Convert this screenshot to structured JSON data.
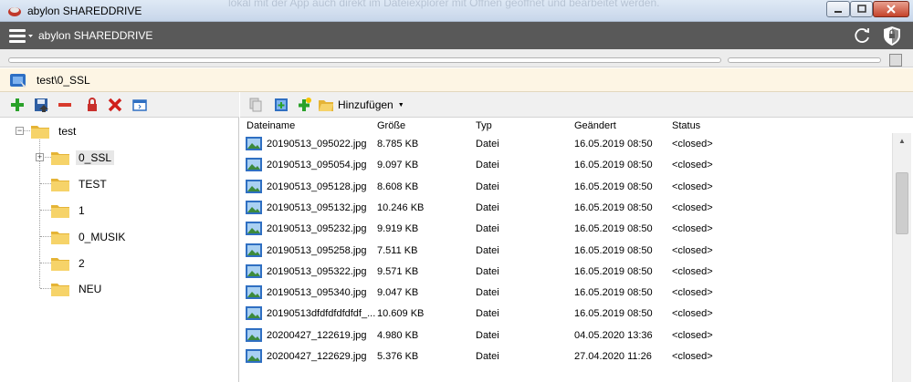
{
  "window": {
    "title": "abylon SHAREDDRIVE",
    "background_text": "lokal mit der App auch direkt im Dateiexplorer mit Öffnen geöffnet und bearbeitet werden."
  },
  "app_header": {
    "name": "abylon SHAREDDRIVE",
    "icons": [
      "menu-icon",
      "sync-icon",
      "shield-icon"
    ]
  },
  "progress": {
    "main_value": 0,
    "secondary_value": 0
  },
  "path": {
    "text": "test\\0_SSL"
  },
  "left_toolbar": {
    "buttons": [
      "add-icon",
      "save-icon",
      "remove-icon",
      "lock-icon",
      "delete-icon",
      "properties-icon"
    ]
  },
  "tree": {
    "root": "test",
    "children": [
      "0_SSL",
      "TEST",
      "1",
      "0_MUSIK",
      "2",
      "NEU"
    ],
    "selected": "0_SSL"
  },
  "right_toolbar": {
    "add_label": "Hinzufügen"
  },
  "file_list": {
    "columns": [
      "Dateiname",
      "Größe",
      "Typ",
      "Geändert",
      "Status"
    ],
    "rows": [
      {
        "name": "20190513_095022.jpg",
        "size": "8.785 KB",
        "type": "Datei",
        "modified": "16.05.2019 08:50",
        "status": "<closed>"
      },
      {
        "name": "20190513_095054.jpg",
        "size": "9.097 KB",
        "type": "Datei",
        "modified": "16.05.2019 08:50",
        "status": "<closed>"
      },
      {
        "name": "20190513_095128.jpg",
        "size": "8.608 KB",
        "type": "Datei",
        "modified": "16.05.2019 08:50",
        "status": "<closed>"
      },
      {
        "name": "20190513_095132.jpg",
        "size": "10.246 KB",
        "type": "Datei",
        "modified": "16.05.2019 08:50",
        "status": "<closed>"
      },
      {
        "name": "20190513_095232.jpg",
        "size": "9.919 KB",
        "type": "Datei",
        "modified": "16.05.2019 08:50",
        "status": "<closed>"
      },
      {
        "name": "20190513_095258.jpg",
        "size": "7.511 KB",
        "type": "Datei",
        "modified": "16.05.2019 08:50",
        "status": "<closed>"
      },
      {
        "name": "20190513_095322.jpg",
        "size": "9.571 KB",
        "type": "Datei",
        "modified": "16.05.2019 08:50",
        "status": "<closed>"
      },
      {
        "name": "20190513_095340.jpg",
        "size": "9.047 KB",
        "type": "Datei",
        "modified": "16.05.2019 08:50",
        "status": "<closed>"
      },
      {
        "name": "20190513dfdfdfdfdfdf_...",
        "size": "10.609 KB",
        "type": "Datei",
        "modified": "16.05.2019 08:50",
        "status": "<closed>"
      },
      {
        "name": "20200427_122619.jpg",
        "size": "4.980 KB",
        "type": "Datei",
        "modified": "04.05.2020 13:36",
        "status": "<closed>"
      },
      {
        "name": "20200427_122629.jpg",
        "size": "5.376 KB",
        "type": "Datei",
        "modified": "27.04.2020 11:26",
        "status": "<closed>"
      }
    ]
  },
  "colors": {
    "header_bg": "#595959",
    "path_bg": "#fdf5e4",
    "folder": "#f2c94c"
  }
}
